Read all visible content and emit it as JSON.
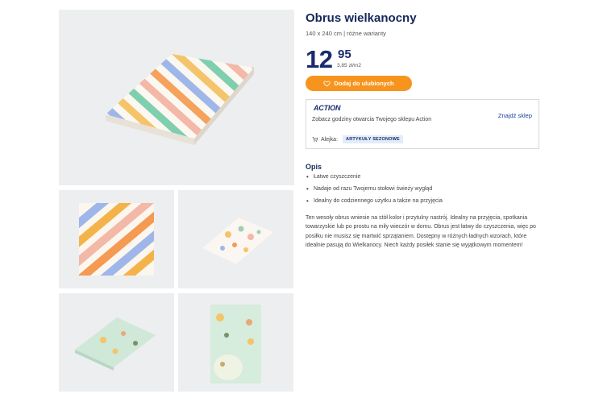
{
  "product": {
    "title": "Obrus wielkanocny",
    "subtitle": "140 x 240 cm | różne warianty",
    "price_int": "12",
    "price_dec": "95",
    "unit_price": "3,85 zł/m2",
    "favorite_label": "Dodaj do ulubionych"
  },
  "store": {
    "brand": "ACTION",
    "hours_text": "Zobacz godziny otwarcia Twojego sklepu Action",
    "find_store_label": "Znajdź sklep",
    "aisle_label": "Alejka:",
    "aisle_badge": "ARTYKUŁY SEZONOWE"
  },
  "description": {
    "heading": "Opis",
    "bullets": [
      "Łatwe czyszczenie",
      "Nadaje od razu Twojemu stołowi świeży wygląd",
      "Idealny do codziennego użytku a także na przyjęcia"
    ],
    "body": "Ten wesoły obrus wniesie na stół kolor i przytulny nastrój. Idealny na przyjęcia, spotkania towarzyskie lub po prostu na miły wieczór w domu. Obrus jest łatwy do czyszczenia, więc po posiłku nie musisz się martwić sprzątaniem. Dostępny w różnych ładnych wzorach, które idealnie pasują do Wielkanocy. Niech każdy posiłek stanie się wyjątkowym momentem!"
  },
  "icons": {
    "favorite": "heart-icon",
    "aisle": "cart-icon"
  },
  "colors": {
    "accent": "#f7941d",
    "brand": "#1a2b6d",
    "badge_bg": "#e3ecf7"
  }
}
